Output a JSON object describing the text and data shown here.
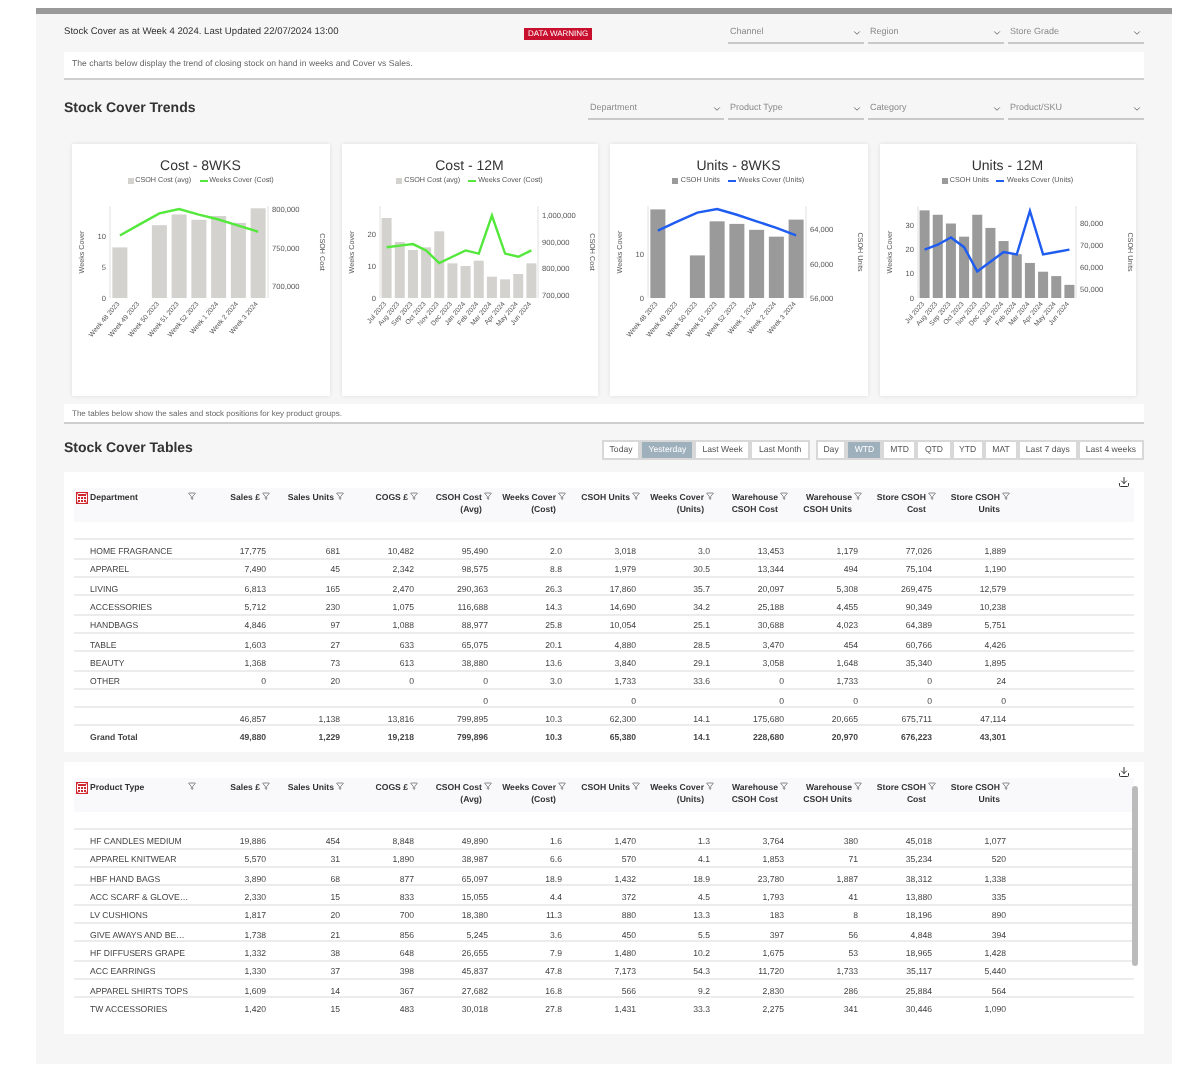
{
  "header": {
    "title": "Stock Cover as at Week 4 2024. Last Updated 22/07/2024 13:00",
    "badge": "DATA WARNING",
    "filters": [
      {
        "placeholder": "Channel"
      },
      {
        "placeholder": "Region"
      },
      {
        "placeholder": "Store Grade"
      }
    ]
  },
  "intro": "The charts below display the trend of closing stock on hand in weeks and Cover vs Sales.",
  "trends": {
    "title": "Stock Cover Trends",
    "filters": [
      {
        "placeholder": "Department"
      },
      {
        "placeholder": "Product Type"
      },
      {
        "placeholder": "Category"
      },
      {
        "placeholder": "Product/SKU"
      }
    ],
    "charts": [
      {
        "chart_data": {
          "type": "bar",
          "legend": "top",
          "title": "Cost - 8WKS",
          "ylabel": "Weeks Cover",
          "y2label": "CSOH Cost",
          "categories": [
            "Week 48 2023",
            "Week 49 2023",
            "Week 50 2023",
            "Week 51 2023",
            "Week 52 2023",
            "Week 1 2024",
            "Week 2 2024",
            "Week 3 2024"
          ],
          "ylim": [
            0,
            15
          ],
          "yticks": [
            0,
            5,
            10
          ],
          "y2lim": [
            685000,
            805000
          ],
          "y2ticks": [
            {
              "value": 700000,
              "label": "700,000"
            },
            {
              "value": 750000,
              "label": "750,000"
            },
            {
              "value": 800000,
              "label": "800,000"
            }
          ],
          "series": [
            {
              "name": "CSOH Cost (avg)",
              "type": "bar",
              "axis": "y2",
              "color": "#d4d2cf",
              "values": [
                751000,
                null,
                780000,
                794000,
                787000,
                792000,
                783000,
                802000
              ]
            },
            {
              "name": "Weeks Cover (Cost)",
              "type": "line",
              "color": "#55e83c",
              "values": [
                10.2,
                12.0,
                13.8,
                14.5,
                13.6,
                12.8,
                11.8,
                10.8
              ]
            }
          ]
        }
      },
      {
        "chart_data": {
          "type": "bar",
          "legend": "top",
          "title": "Cost - 12M",
          "ylabel": "Weeks Cover",
          "y2label": "CSOH Cost",
          "categories": [
            "Jul 2023",
            "Aug 2023",
            "Sep 2023",
            "Oct 2023",
            "Nov 2023",
            "Dec 2023",
            "Jan 2024",
            "Feb 2024",
            "Mar 2024",
            "Apr 2024",
            "May 2024",
            "Jun 2024"
          ],
          "ylim": [
            0,
            29
          ],
          "yticks": [
            0,
            10,
            20
          ],
          "y2lim": [
            690000,
            1035000
          ],
          "y2ticks": [
            {
              "value": 700000,
              "label": "700,000"
            },
            {
              "value": 800000,
              "label": "800,000"
            },
            {
              "value": 900000,
              "label": "900,000"
            },
            {
              "value": 1000000,
              "label": "1,000,000"
            }
          ],
          "series": [
            {
              "name": "CSOH Cost (avg)",
              "type": "bar",
              "axis": "y2",
              "color": "#d4d2cf",
              "values": [
                990000,
                900000,
                870000,
                880000,
                940000,
                820000,
                810000,
                830000,
                770000,
                760000,
                780000,
                820000
              ]
            },
            {
              "name": "Weeks Cover (Cost)",
              "type": "line",
              "color": "#55e83c",
              "values": [
                16,
                16.5,
                17,
                15,
                11,
                13,
                15,
                14,
                26,
                14,
                13,
                15
              ]
            }
          ]
        }
      },
      {
        "chart_data": {
          "type": "bar",
          "legend": "top",
          "title": "Units - 8WKS",
          "ylabel": "Weeks Cover",
          "y2label": "CSOH Units",
          "categories": [
            "Week 48 2023",
            "Week 49 2023",
            "Week 50 2023",
            "Week 51 2023",
            "Week 52 2023",
            "Week 1 2024",
            "Week 2 2024",
            "Week 3 2024"
          ],
          "ylim": [
            0,
            21
          ],
          "yticks": [
            0,
            10
          ],
          "y2lim": [
            56000,
            66800
          ],
          "y2ticks": [
            {
              "value": 56000,
              "label": "56,000"
            },
            {
              "value": 60000,
              "label": "60,000"
            },
            {
              "value": 64000,
              "label": "64,000"
            }
          ],
          "series": [
            {
              "name": "CSOH Units",
              "type": "bar",
              "axis": "y2",
              "color": "#9a9a9a",
              "values": [
                66400,
                null,
                61000,
                65000,
                64700,
                64000,
                63200,
                65200
              ]
            },
            {
              "name": "Weeks Cover (Units)",
              "type": "line",
              "color": "#1f5cf0",
              "values": [
                15.4,
                17.5,
                19.5,
                20.3,
                19,
                17.5,
                16,
                14.3
              ]
            }
          ]
        }
      },
      {
        "chart_data": {
          "type": "bar",
          "legend": "top",
          "title": "Units - 12M",
          "ylabel": "Weeks Cover",
          "y2label": "CSOH Units",
          "categories": [
            "Jul 2023",
            "Aug 2023",
            "Sep 2023",
            "Oct 2023",
            "Nov 2023",
            "Dec 2023",
            "Jan 2024",
            "Feb 2024",
            "Mar 2024",
            "Apr 2024",
            "May 2024",
            "Jun 2024"
          ],
          "ylim": [
            0,
            38
          ],
          "yticks": [
            0,
            10,
            20,
            30
          ],
          "y2lim": [
            46000,
            88000
          ],
          "y2ticks": [
            {
              "value": 50000,
              "label": "50,000"
            },
            {
              "value": 60000,
              "label": "60,000"
            },
            {
              "value": 70000,
              "label": "70,000"
            },
            {
              "value": 80000,
              "label": "80,000"
            }
          ],
          "series": [
            {
              "name": "CSOH Units",
              "type": "bar",
              "axis": "y2",
              "color": "#9a9a9a",
              "values": [
                86000,
                84000,
                80000,
                74000,
                84000,
                78000,
                72000,
                66000,
                62000,
                58000,
                56000,
                52000
              ]
            },
            {
              "name": "Weeks Cover (Units)",
              "type": "line",
              "color": "#1f5cf0",
              "values": [
                20,
                22,
                25,
                21,
                11,
                15,
                19,
                18,
                36,
                18,
                19,
                20
              ]
            }
          ]
        }
      }
    ]
  },
  "tables_note": "The tables below show the sales and stock positions for key product groups.",
  "tables_section": {
    "title": "Stock Cover Tables",
    "period_buttons": [
      {
        "label": "Today",
        "selected": false
      },
      {
        "label": "Yesterday",
        "selected": true
      },
      {
        "label": "Last Week",
        "selected": false
      },
      {
        "label": "Last Month",
        "selected": false
      }
    ],
    "range_buttons": [
      {
        "label": "Day",
        "selected": false
      },
      {
        "label": "WTD",
        "selected": true
      },
      {
        "label": "MTD",
        "selected": false
      },
      {
        "label": "QTD",
        "selected": false
      },
      {
        "label": "YTD",
        "selected": false
      },
      {
        "label": "MAT",
        "selected": false
      },
      {
        "label": "Last 7 days",
        "selected": false
      },
      {
        "label": "Last 4 weeks",
        "selected": false
      }
    ],
    "tables": [
      {
        "scrollbar": false,
        "columns": [
          "Department",
          "Sales £",
          "Sales Units",
          "COGS £",
          "CSOH Cost (Avg)",
          "Weeks Cover (Cost)",
          "CSOH Units",
          "Weeks Cover (Units)",
          "Warehouse CSOH Cost",
          "Warehouse CSOH Units",
          "Store CSOH Cost",
          "Store CSOH Units"
        ],
        "rows": [
          {
            "kind": "data",
            "cells": [
              "HOME FRAGRANCE",
              "17,775",
              "681",
              "10,482",
              "95,490",
              "2.0",
              "3,018",
              "3.0",
              "13,453",
              "1,179",
              "77,026",
              "1,889"
            ]
          },
          {
            "kind": "data",
            "cells": [
              "APPAREL",
              "7,490",
              "45",
              "2,342",
              "98,575",
              "8.8",
              "1,979",
              "30.5",
              "13,344",
              "494",
              "75,104",
              "1,190"
            ]
          },
          {
            "kind": "data",
            "cells": [
              "LIVING",
              "6,813",
              "165",
              "2,470",
              "290,363",
              "26.3",
              "17,860",
              "35.7",
              "20,097",
              "5,308",
              "269,475",
              "12,579"
            ]
          },
          {
            "kind": "data",
            "cells": [
              "ACCESSORIES",
              "5,712",
              "230",
              "1,075",
              "116,688",
              "14.3",
              "14,690",
              "34.2",
              "25,188",
              "4,455",
              "90,349",
              "10,238"
            ]
          },
          {
            "kind": "data",
            "cells": [
              "HANDBAGS",
              "4,846",
              "97",
              "1,088",
              "88,977",
              "25.8",
              "10,054",
              "25.1",
              "30,688",
              "4,023",
              "64,389",
              "5,751"
            ]
          },
          {
            "kind": "data",
            "cells": [
              "TABLE",
              "1,603",
              "27",
              "633",
              "65,075",
              "20.1",
              "4,880",
              "28.5",
              "3,470",
              "454",
              "60,766",
              "4,426"
            ]
          },
          {
            "kind": "data",
            "cells": [
              "BEAUTY",
              "1,368",
              "73",
              "613",
              "38,880",
              "13.6",
              "3,840",
              "29.1",
              "3,058",
              "1,648",
              "35,340",
              "1,895"
            ]
          },
          {
            "kind": "data",
            "cells": [
              "OTHER",
              "0",
              "20",
              "0",
              "0",
              "3.0",
              "1,733",
              "33.6",
              "0",
              "1,733",
              "0",
              "24"
            ]
          },
          {
            "kind": "data",
            "cells": [
              null,
              null,
              null,
              null,
              "0",
              null,
              "0",
              null,
              "0",
              "0",
              "0",
              "0"
            ]
          },
          {
            "kind": "data",
            "cells": [
              null,
              "46,857",
              "1,138",
              "13,816",
              "799,895",
              "10.3",
              "62,300",
              "14.1",
              "175,680",
              "20,665",
              "675,711",
              "47,114"
            ]
          },
          {
            "kind": "total",
            "cells": [
              "Grand Total",
              "49,880",
              "1,229",
              "19,218",
              "799,896",
              "10.3",
              "65,380",
              "14.1",
              "228,680",
              "20,970",
              "676,223",
              "43,301"
            ]
          }
        ]
      },
      {
        "scrollbar": true,
        "columns": [
          "Product Type",
          "Sales £",
          "Sales Units",
          "COGS £",
          "CSOH Cost (Avg)",
          "Weeks Cover (Cost)",
          "CSOH Units",
          "Weeks Cover (Units)",
          "Warehouse CSOH Cost",
          "Warehouse CSOH Units",
          "Store CSOH Cost",
          "Store CSOH Units"
        ],
        "rows": [
          {
            "kind": "data",
            "cells": [
              "HF CANDLES MEDIUM",
              "19,886",
              "454",
              "8,848",
              "49,890",
              "1.6",
              "1,470",
              "1.3",
              "3,764",
              "380",
              "45,018",
              "1,077"
            ]
          },
          {
            "kind": "data",
            "cells": [
              "APPAREL KNITWEAR",
              "5,570",
              "31",
              "1,890",
              "38,987",
              "6.6",
              "570",
              "4.1",
              "1,853",
              "71",
              "35,234",
              "520"
            ]
          },
          {
            "kind": "data",
            "cells": [
              "HBF HAND BAGS",
              "3,890",
              "68",
              "877",
              "65,097",
              "18.9",
              "1,432",
              "18.9",
              "23,780",
              "1,887",
              "38,312",
              "1,338"
            ]
          },
          {
            "kind": "data",
            "cells": [
              "ACC SCARF & GLOVE…",
              "2,330",
              "15",
              "833",
              "15,055",
              "4.4",
              "372",
              "4.5",
              "1,793",
              "41",
              "13,880",
              "335"
            ]
          },
          {
            "kind": "data",
            "cells": [
              "LV CUSHIONS",
              "1,817",
              "20",
              "700",
              "18,380",
              "11.3",
              "880",
              "13.3",
              "183",
              "8",
              "18,196",
              "890"
            ]
          },
          {
            "kind": "data",
            "cells": [
              "GIVE AWAYS AND BE…",
              "1,738",
              "21",
              "856",
              "5,245",
              "3.6",
              "450",
              "5.5",
              "397",
              "56",
              "4,848",
              "394"
            ]
          },
          {
            "kind": "data",
            "cells": [
              "HF DIFFUSERS GRAPE",
              "1,332",
              "38",
              "648",
              "26,655",
              "7.9",
              "1,480",
              "10.2",
              "1,675",
              "53",
              "18,965",
              "1,428"
            ]
          },
          {
            "kind": "data",
            "cells": [
              "ACC EARRINGS",
              "1,330",
              "37",
              "398",
              "45,837",
              "47.8",
              "7,173",
              "54.3",
              "11,720",
              "1,733",
              "35,117",
              "5,440"
            ]
          },
          {
            "kind": "data",
            "cells": [
              "APPAREL SHIRTS TOPS",
              "1,609",
              "14",
              "367",
              "27,682",
              "16.8",
              "566",
              "9.2",
              "2,830",
              "286",
              "25,884",
              "564"
            ]
          },
          {
            "kind": "data",
            "cells": [
              "TW ACCESSORIES",
              "1,420",
              "15",
              "483",
              "30,018",
              "27.8",
              "1,431",
              "33.3",
              "2,275",
              "341",
              "30,446",
              "1,090"
            ]
          }
        ]
      }
    ]
  }
}
